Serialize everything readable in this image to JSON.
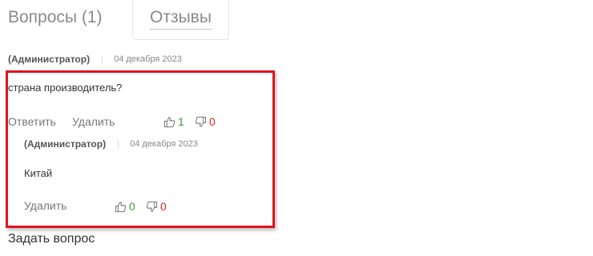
{
  "tabs": {
    "questions_label": "Вопросы (1)",
    "reviews_label": "Отзывы"
  },
  "question": {
    "author": "(Администратор)",
    "date": "04 декабря 2023",
    "text": "страна производитель?",
    "reply_label": "Ответить",
    "delete_label": "Удалить",
    "likes": "1",
    "dislikes": "0"
  },
  "answer": {
    "author": "(Администратор)",
    "date": "04 декабря 2023",
    "text": "Китай",
    "delete_label": "Удалить",
    "likes": "0",
    "dislikes": "0"
  },
  "ask_question_label": "Задать вопрос",
  "colors": {
    "highlight": "#e0141e",
    "like": "#3a9a3a",
    "dislike": "#e02020"
  }
}
